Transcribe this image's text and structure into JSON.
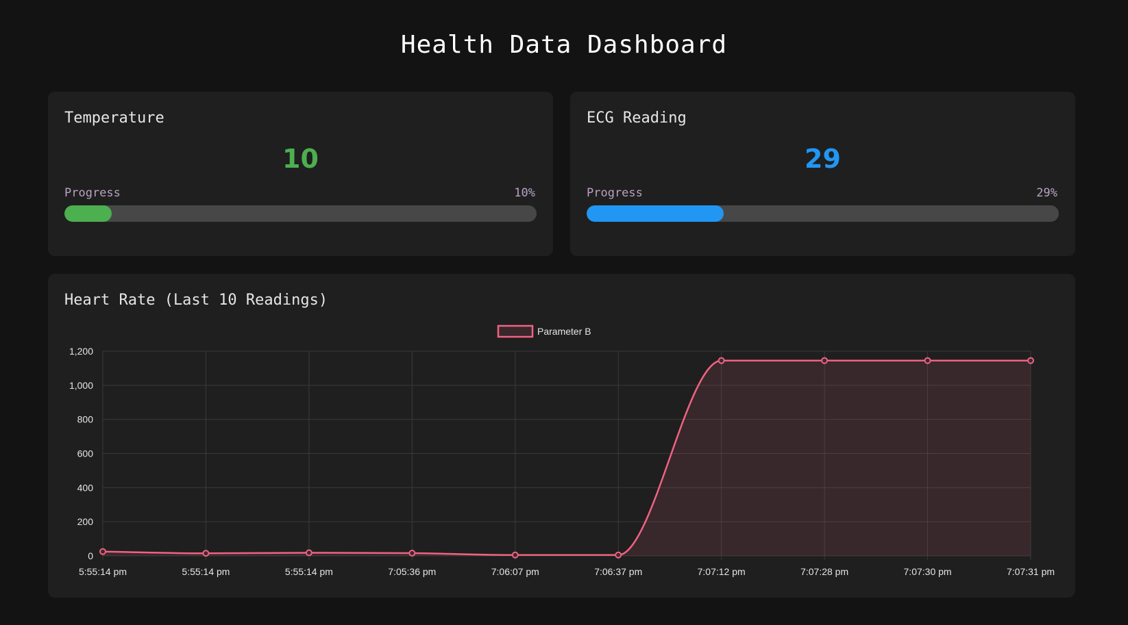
{
  "page": {
    "title": "Health Data Dashboard"
  },
  "temperature": {
    "title": "Temperature",
    "value": "10",
    "progress_label": "Progress",
    "progress_text": "10%",
    "progress_fraction": 0.1,
    "color": "#4caf50"
  },
  "ecg": {
    "title": "ECG Reading",
    "value": "29",
    "progress_label": "Progress",
    "progress_text": "29%",
    "progress_fraction": 0.29,
    "color": "#2196f3"
  },
  "heart_rate": {
    "title": "Heart Rate (Last 10 Readings)"
  },
  "chart_data": {
    "type": "line",
    "title": "Heart Rate (Last 10 Readings)",
    "categories": [
      "5:55:14 pm",
      "5:55:14 pm",
      "5:55:14 pm",
      "7:05:36 pm",
      "7:06:07 pm",
      "7:06:37 pm",
      "7:07:12 pm",
      "7:07:28 pm",
      "7:07:30 pm",
      "7:07:31 pm"
    ],
    "series": [
      {
        "name": "Parameter B",
        "values": [
          25,
          15,
          18,
          16,
          5,
          5,
          1145,
          1145,
          1145,
          1145
        ],
        "color": "#f06383",
        "fill": "rgba(240, 99, 131, 0.12)"
      }
    ],
    "ylim": [
      0,
      1200
    ],
    "yticks": [
      "0",
      "200",
      "400",
      "600",
      "800",
      "1,000",
      "1,200"
    ],
    "ytick_values": [
      0,
      200,
      400,
      600,
      800,
      1000,
      1200
    ],
    "legend": "top-center",
    "grid": true,
    "smooth": true
  }
}
